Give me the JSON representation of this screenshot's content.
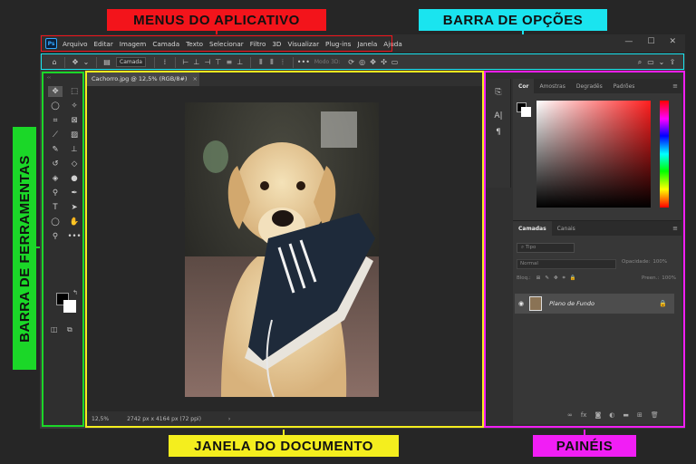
{
  "callouts": {
    "menus": "MENUS DO APLICATIVO",
    "options": "BARRA DE OPÇÕES",
    "tools": "BARRA DE FERRAMENTAS",
    "document": "JANELA DO DOCUMENTO",
    "panels": "PAINÉIS"
  },
  "colors": {
    "menus": "#f3141b",
    "options": "#1ae4ef",
    "tools": "#1bd728",
    "document": "#f4ee1e",
    "panels": "#f11ef5"
  },
  "menubar": {
    "logo": "Ps",
    "items": [
      "Arquivo",
      "Editar",
      "Imagem",
      "Camada",
      "Texto",
      "Selecionar",
      "Filtro",
      "3D",
      "Visualizar",
      "Plug-ins",
      "Janela",
      "Ajuda"
    ],
    "minimize": "—",
    "maximize": "☐",
    "close": "✕"
  },
  "options_bar": {
    "layer_select": "Camada",
    "mode_3d": "Modo 3D:"
  },
  "document": {
    "tab_title": "Cachorro.jpg @ 12,5% (RGB/8#)",
    "tab_close": "×",
    "zoom": "12,5%",
    "dimensions": "2742 px x 4164 px (72 ppi)",
    "status_arrow": "›"
  },
  "color_panel": {
    "tabs": [
      "Cor",
      "Amostras",
      "Degradês",
      "Padrões"
    ]
  },
  "layers_panel": {
    "tabs": [
      "Camadas",
      "Canais"
    ],
    "search_placeholder": "Tipo",
    "blend_mode": "Normal",
    "opacity_label": "Opacidade:",
    "opacity_value": "100%",
    "lock_label": "Bloq.:",
    "fill_label": "Preen.:",
    "fill_value": "100%",
    "layer_name": "Plano de Fundo"
  }
}
